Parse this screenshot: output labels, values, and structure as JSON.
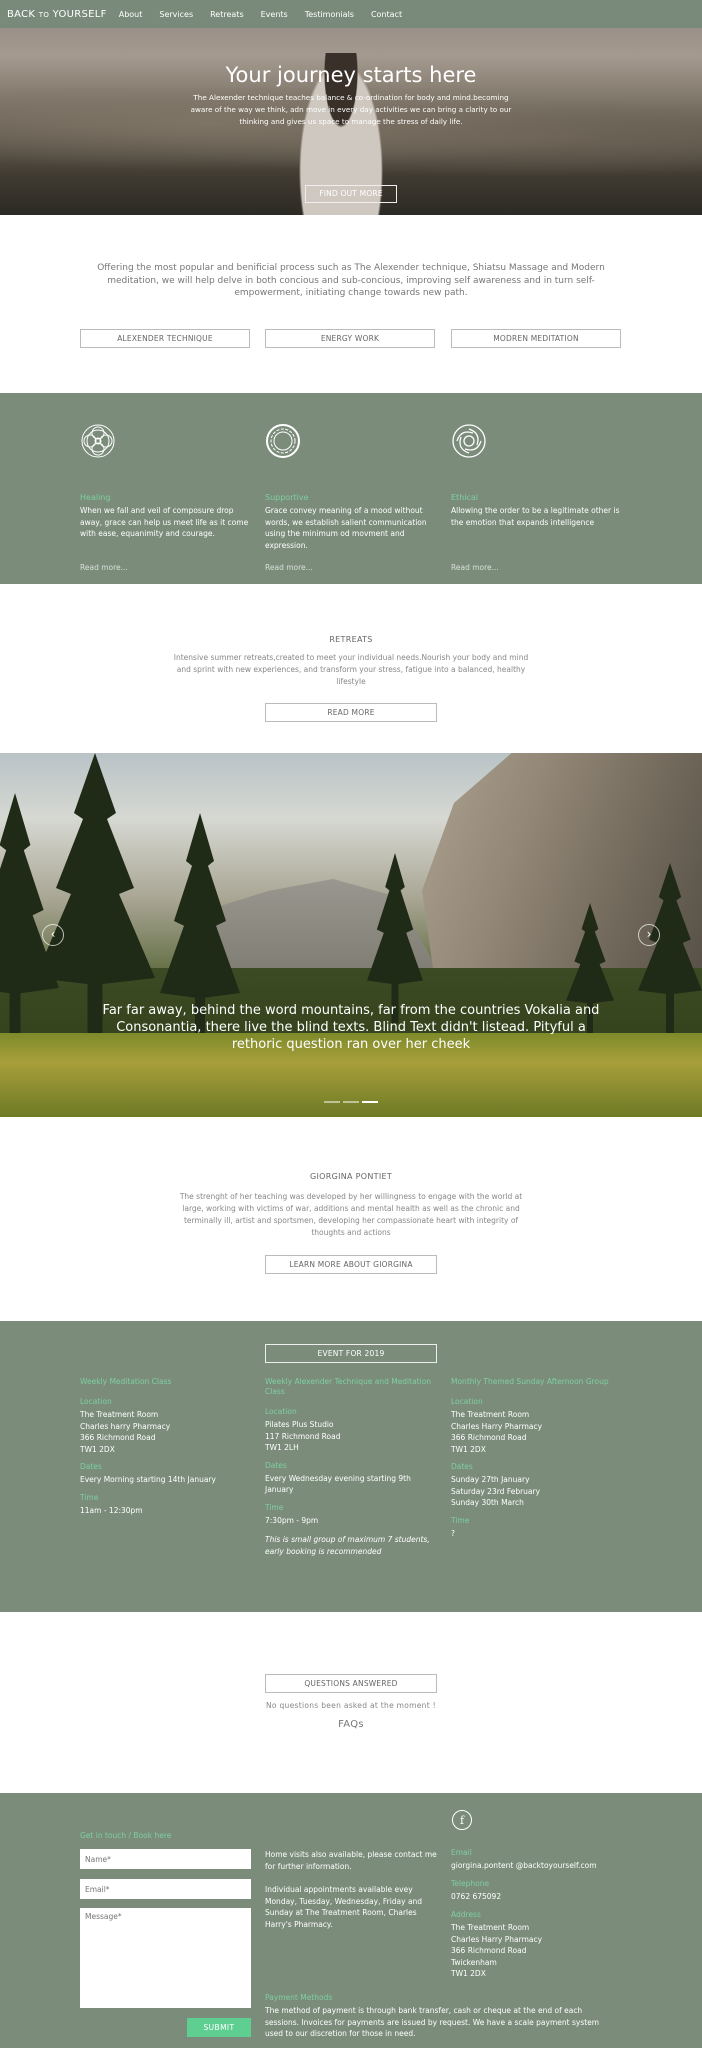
{
  "nav": {
    "brand_main": "BACK",
    "brand_small": "TO",
    "brand_end": "YOURSELF",
    "items": [
      "About",
      "Services",
      "Retreats",
      "Events",
      "Testimonials",
      "Contact"
    ]
  },
  "hero": {
    "title": "Your journey starts here",
    "text": "The Alexender technique teaches balance & co-ordination for body and mind.becoming aware of the way we think, adn move in every day activities we can bring a clarity to our thinking and gives us space to manage the stress of daily life.",
    "button": "FIND OUT MORE"
  },
  "intro": {
    "text": "Offering the most popular and benificial process such as The Alexender technique, Shiatsu Massage and Modern meditation, we will help delve in both concious and sub-concious, improving self awareness and in turn self-empowerment, initiating change towards new path.",
    "buttons": [
      "ALEXENDER TECHNIQUE",
      "ENERGY WORK",
      "MODREN MEDITATION"
    ]
  },
  "features": [
    {
      "icon": "mandala-icon",
      "title": "Healing",
      "text": "When we fall and veil of composure drop away, grace can help us meet life as it come with ease, equanimity and courage.",
      "link": "Read more..."
    },
    {
      "icon": "ring-icon",
      "title": "Supportive",
      "text": "Grace convey meaning of a mood without words, we establish salient communication using the minimum od movment and expression.",
      "link": "Read more..."
    },
    {
      "icon": "swirl-icon",
      "title": "Ethical",
      "text": "Allowing the order to be a legitimate other is the emotion that expands intelligence",
      "link": "Read more..."
    }
  ],
  "retreats": {
    "title": "RETREATS",
    "text": "Intensive summer retreats,created to meet your individual needs.Nourish your body and mind and sprint with new experiences, and transform your stress, fatigue into a balanced, healthy lifestyle",
    "button": "READ MORE"
  },
  "slider": {
    "quote": "Far far away, behind the word mountains, far from the countries Vokalia and Consonantia, there live the blind texts. Blind Text didn't listead. Pityful a rethoric question ran over her cheek",
    "prev": "‹",
    "next": "›"
  },
  "about": {
    "title": "GIORGINA PONTIET",
    "text": "The strenght of her teaching was developed by her willingness to engage with the world at large, working with victims of war, additions and mental health as well as the chronic and terminally ill, artist and sportsmen, developing her compassionate heart with integrity of thoughts and actions",
    "button": "LEARN MORE ABOUT GIORGINA"
  },
  "events": {
    "heading": "EVENT FOR 2019",
    "labels": {
      "location": "Location",
      "dates": "Dates",
      "time": "Time"
    },
    "items": [
      {
        "title": "Weekly Meditation Class",
        "location": "The Treatment Room\nCharles harry Pharmacy\n366 Richmond Road\nTW1 2DX",
        "dates": "Every Morning starting 14th January",
        "time": "11am - 12:30pm",
        "note": ""
      },
      {
        "title": "Weekly Alexender Technique and Meditation Class",
        "location": "Pilates Plus Studio\n117 Richmond Road\nTW1 2LH",
        "dates": "Every Wednesday evening starting 9th January",
        "time": "7:30pm - 9pm",
        "note": "This is small group of maximum 7 students,\nearly booking is recommended"
      },
      {
        "title": "Monthly Themed Sunday Afternoon Group",
        "location": "The Treatment Room\nCharles Harry Pharmacy\n366 Richmond Road\nTW1 2DX",
        "dates": "Sunday 27th January\nSaturday 23rd February\nSunday 30th March",
        "time": "?",
        "note": ""
      }
    ]
  },
  "faq": {
    "button": "QUESTIONS ANSWERED",
    "empty": "No questions been asked at the moment !",
    "link": "FAQs"
  },
  "footer": {
    "form_title": "Get in touch / Book here",
    "name_placeholder": "Name*",
    "email_placeholder": "Email*",
    "message_placeholder": "Message*",
    "submit": "SUBMIT",
    "home_visits": "Home visits also available, please contact me for further information.",
    "appointments": "Individual appointments available evey Monday, Tuesday, Wednesday, Friday and Sunday at The Treatment Room, Charles Harry's Pharmacy.",
    "payment_title": "Payment Methods",
    "payment_text": "The method of payment is through bank transfer, cash or cheque at the end of each sessions. Invoices for payments are issued by request. We have a scale payment system used to our discretion for those in need.",
    "facebook": "f",
    "email_label": "Email",
    "email": "giorgina.pontent @backtoyourself.com",
    "phone_label": "Telephone",
    "phone": "0762 675092",
    "address_label": "Address",
    "address": "The Treatment Room\nCharles Harry Pharmacy\n366 Richmond Road\nTwickenham\nTW1 2DX"
  },
  "colors": {
    "green_bg": "#7b8c7b",
    "accent": "#7ecfa0",
    "submit": "#5fcf91"
  }
}
